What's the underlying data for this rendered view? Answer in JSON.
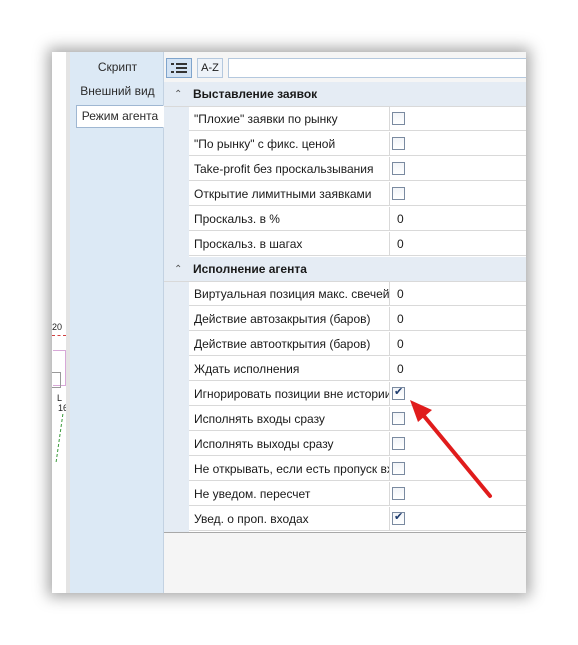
{
  "tabs": [
    {
      "label": "Скрипт",
      "active": false
    },
    {
      "label": "Внешний вид",
      "active": false
    },
    {
      "label": "Режим агента",
      "active": true
    }
  ],
  "toolbar": {
    "categorized_icon": "categorized-list-icon",
    "alphabetical_label": "A-Z"
  },
  "chart_fragment": {
    "label_top": "20",
    "label_l": "L",
    "label_16": "16"
  },
  "categories": [
    {
      "title": "Выставление заявок",
      "expanded": true,
      "rows": [
        {
          "name": "\"Плохие\" заявки по рынку",
          "type": "checkbox",
          "checked": false
        },
        {
          "name": "\"По рынку\" с фикс. ценой",
          "type": "checkbox",
          "checked": false
        },
        {
          "name": "Take-profit без проскальзывания",
          "type": "checkbox",
          "checked": false
        },
        {
          "name": "Открытие лимитными заявками",
          "type": "checkbox",
          "checked": false
        },
        {
          "name": "Проскальз. в %",
          "type": "text",
          "value": "0"
        },
        {
          "name": "Проскальз. в шагах",
          "type": "text",
          "value": "0"
        }
      ]
    },
    {
      "title": "Исполнение агента",
      "expanded": true,
      "rows": [
        {
          "name": "Виртуальная позиция макс. свечей",
          "type": "text",
          "value": "0"
        },
        {
          "name": "Действие автозакрытия (баров)",
          "type": "text",
          "value": "0"
        },
        {
          "name": "Действие автооткрытия (баров)",
          "type": "text",
          "value": "0"
        },
        {
          "name": "Ждать исполнения",
          "type": "text",
          "value": "0"
        },
        {
          "name": "Игнорировать позиции вне истории",
          "type": "checkbox",
          "checked": true
        },
        {
          "name": "Исполнять входы сразу",
          "type": "checkbox",
          "checked": false
        },
        {
          "name": "Исполнять выходы сразу",
          "type": "checkbox",
          "checked": false
        },
        {
          "name": "Не открывать, если есть пропуск входа",
          "type": "checkbox",
          "checked": false
        },
        {
          "name": "Не уведом. пересчет",
          "type": "checkbox",
          "checked": false
        },
        {
          "name": "Увед. о проп. входах",
          "type": "checkbox",
          "checked": true
        }
      ]
    }
  ],
  "annotation": {
    "arrow_color": "#e01c1c",
    "points_to": "Игнорировать позиции вне истории"
  }
}
